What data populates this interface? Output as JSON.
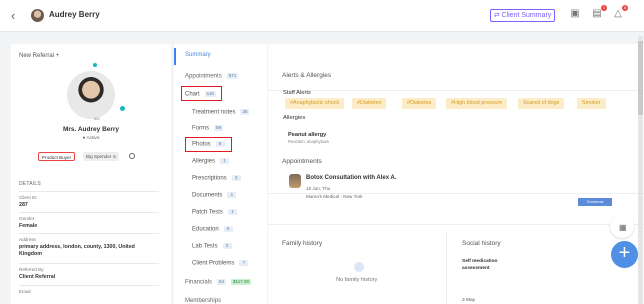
{
  "header": {
    "back": "‹",
    "name": "Audrey Berry",
    "button": "Client Summary",
    "button_icon": "⇄",
    "notifications": [
      "1",
      "8"
    ]
  },
  "profile": {
    "new_referral": "New Referral +",
    "display_name": "Mrs. Audrey Berry",
    "status": "Active",
    "tags": [
      "Product Buyer",
      "Big Spender ⊙"
    ],
    "avatar_label": "6M",
    "details_title": "DETAILS",
    "fields": [
      {
        "label": "Client ID",
        "value": "287"
      },
      {
        "label": "Gender",
        "value": "Female"
      },
      {
        "label": "Address",
        "value": "primary address, london, county, 1300, United Kingdom"
      },
      {
        "label": "Referred By",
        "value": "Client Referral"
      },
      {
        "label": "Email",
        "value": ""
      }
    ]
  },
  "menu": {
    "summary": "Summary",
    "appointments": {
      "label": "Appointments",
      "badge": "571"
    },
    "chart": {
      "label": "Chart",
      "badge": "116"
    },
    "subitems": [
      {
        "label": "Treatment notes",
        "badge": "35"
      },
      {
        "label": "Forms",
        "badge": "59"
      },
      {
        "label": "Photos",
        "badge": "6"
      },
      {
        "label": "Allergies",
        "badge": "1"
      },
      {
        "label": "Prescriptions",
        "badge": "3"
      },
      {
        "label": "Documents",
        "badge": "1"
      },
      {
        "label": "Patch Tests",
        "badge": "1"
      },
      {
        "label": "Education",
        "badge": "6"
      },
      {
        "label": "Lab Tests",
        "badge": "2"
      },
      {
        "label": "Client Problems",
        "badge": "7"
      }
    ],
    "financials": {
      "label": "Financials",
      "badge": "54",
      "amount": "$117.00"
    },
    "memberships": "Memberships"
  },
  "content": {
    "alerts_title": "Alerts & Allergies",
    "staff_alerts": "Staff Alerts",
    "alerts": [
      "#Anaphylactic shock",
      "#Diabetes",
      "#Diabetes",
      "#High blood pressure",
      "Scared of dogs",
      "Smoker"
    ],
    "allergies_title": "Allergies",
    "allergy_name": "Peanut allergy",
    "allergy_reaction": "Reaction: anaphylaxis",
    "appointments_title": "Appointments",
    "appointment_name": "Botox Consultation with Alex A.",
    "appointment_date": "16 Jun, Thu",
    "appointment_location": "Mama's Medical - New York",
    "appointment_badge": "Tomorrow",
    "family_title": "Family history",
    "family_empty": "No family history",
    "social_title": "Social history",
    "social_label": "Self medication",
    "social_value": "assessment",
    "social_date": "3 May"
  },
  "colors": {
    "accent": "#7b61ff",
    "blue": "#3b82f6",
    "red_box": "#e01b24",
    "alert_bg": "#fdecc8",
    "alert_text": "#d59b20"
  }
}
